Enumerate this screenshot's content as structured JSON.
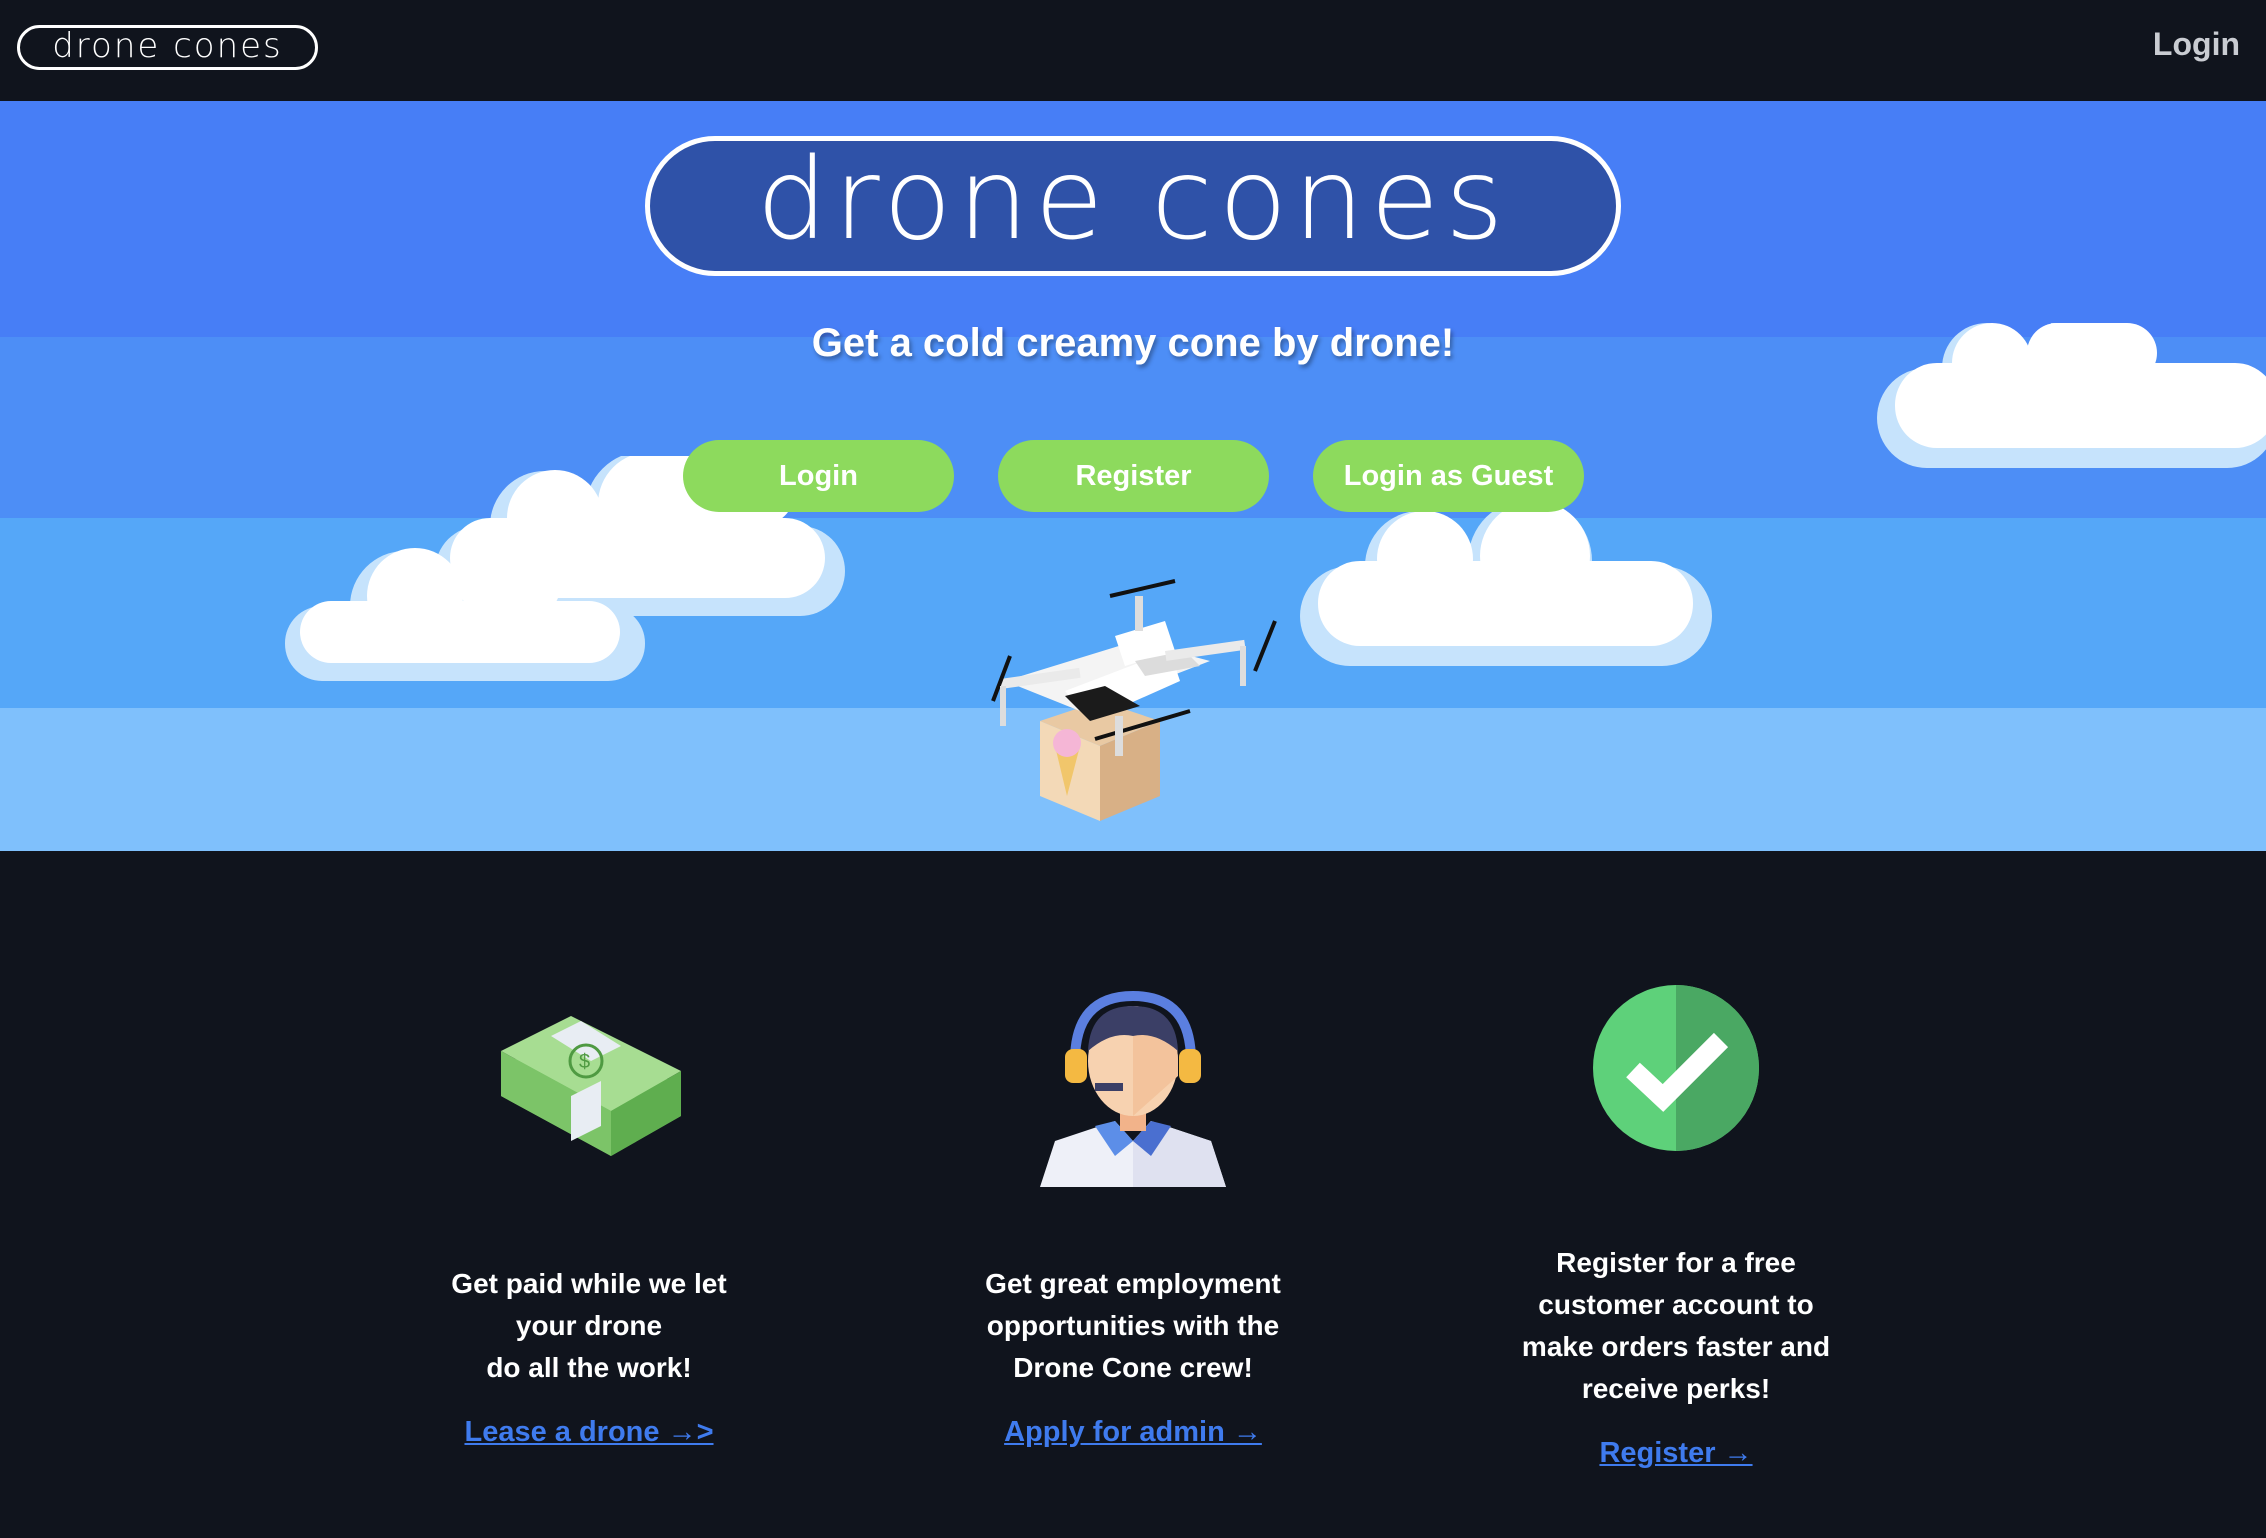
{
  "navbar": {
    "logo_text": "drone cones",
    "login_label": "Login"
  },
  "hero": {
    "logo_text": "drone cones",
    "tagline": "Get a cold creamy cone by drone!",
    "buttons": {
      "login": "Login",
      "register": "Register",
      "guest": "Login as Guest"
    }
  },
  "features": [
    {
      "icon": "money-icon",
      "lines": [
        "Get paid while we let",
        "your drone",
        "do all the work!"
      ],
      "link": "Lease a drone →>"
    },
    {
      "icon": "support-agent-icon",
      "lines": [
        "Get great employment",
        "opportunities with the",
        "Drone Cone crew!"
      ],
      "link": "Apply for admin →"
    },
    {
      "icon": "checkmark-icon",
      "lines": [
        "Register for a free",
        "customer account to",
        "make orders faster and",
        "receive perks!"
      ],
      "link": "Register →"
    }
  ],
  "colors": {
    "nav_bg": "#10141d",
    "button_green": "#8dda5d",
    "link_blue": "#3f7bee",
    "sky_top": "#477ef6"
  }
}
